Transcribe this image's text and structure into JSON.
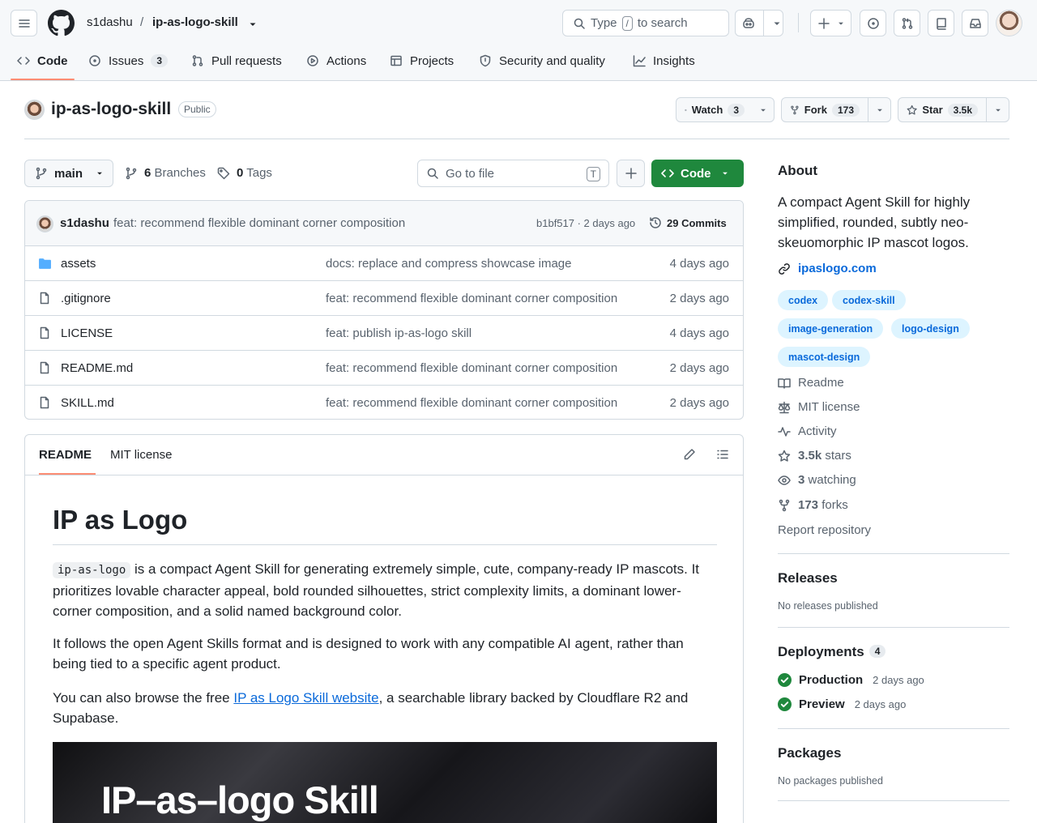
{
  "header": {
    "owner": "s1dashu",
    "separator": "/",
    "repo": "ip-as-logo-skill",
    "search_before": "Type",
    "search_key": "/",
    "search_after": "to search"
  },
  "tabs": [
    {
      "label": "Code"
    },
    {
      "label": "Issues",
      "count": "3"
    },
    {
      "label": "Pull requests"
    },
    {
      "label": "Actions"
    },
    {
      "label": "Projects"
    },
    {
      "label": "Security and quality"
    },
    {
      "label": "Insights"
    }
  ],
  "repo": {
    "title": "ip-as-logo-skill",
    "visibility": "Public",
    "watch_label": "Watch",
    "watch_count": "3",
    "fork_label": "Fork",
    "fork_count": "173",
    "star_label": "Star",
    "star_count": "3.5k"
  },
  "toolbar": {
    "branch": "main",
    "branches_count": "6",
    "branches_label": "Branches",
    "tags_count": "0",
    "tags_label": "Tags",
    "goto_placeholder": "Go to file",
    "goto_key": "T",
    "code_label": "Code"
  },
  "commit": {
    "author": "s1dashu",
    "message": "feat: recommend flexible dominant corner composition",
    "hash_time": "b1bf517 · 2 days ago",
    "commits_label": "29 Commits"
  },
  "files": [
    {
      "name": "assets",
      "type": "folder",
      "message": "docs: replace and compress showcase image",
      "date": "4 days ago"
    },
    {
      "name": ".gitignore",
      "type": "file",
      "message": "feat: recommend flexible dominant corner composition",
      "date": "2 days ago"
    },
    {
      "name": "LICENSE",
      "type": "file",
      "message": "feat: publish ip-as-logo skill",
      "date": "4 days ago"
    },
    {
      "name": "README.md",
      "type": "file",
      "message": "feat: recommend flexible dominant corner composition",
      "date": "2 days ago"
    },
    {
      "name": "SKILL.md",
      "type": "file",
      "message": "feat: recommend flexible dominant corner composition",
      "date": "2 days ago"
    }
  ],
  "readme": {
    "tab_readme": "README",
    "tab_license": "MIT license",
    "h1": "IP as Logo",
    "p1_code": "ip-as-logo",
    "p1_text": " is a compact Agent Skill for generating extremely simple, cute, company-ready IP mascots. It prioritizes lovable character appeal, bold rounded silhouettes, strict complexity limits, a dominant lower-corner composition, and a solid named background color.",
    "p2": "It follows the open Agent Skills format and is designed to work with any compatible AI agent, rather than being tied to a specific agent product.",
    "p3_before": "You can also browse the free ",
    "p3_link": "IP as Logo Skill website",
    "p3_after": ", a searchable library backed by Cloudflare R2 and Supabase.",
    "hero_text": "IP–as–logo Skill"
  },
  "about": {
    "heading": "About",
    "description": "A compact Agent Skill for highly simplified, rounded, subtly neo-skeuomorphic IP mascot logos.",
    "url": "ipaslogo.com",
    "topics": [
      "codex",
      "codex-skill",
      "image-generation",
      "logo-design",
      "mascot-design"
    ],
    "readme": "Readme",
    "license": "MIT license",
    "activity": "Activity",
    "stars_count": "3.5k",
    "stars_label": "stars",
    "watching_count": "3",
    "watching_label": "watching",
    "forks_count": "173",
    "forks_label": "forks",
    "report": "Report repository"
  },
  "releases": {
    "heading": "Releases",
    "empty": "No releases published"
  },
  "deployments": {
    "heading": "Deployments",
    "count": "4",
    "items": [
      {
        "name": "Production",
        "time": "2 days ago"
      },
      {
        "name": "Preview",
        "time": "2 days ago"
      }
    ]
  },
  "packages": {
    "heading": "Packages",
    "empty": "No packages published"
  },
  "colors": {
    "accent": "#1f883d",
    "link": "#0969da",
    "tab_underline": "#fd8c73",
    "topic_bg": "#ddf4ff"
  }
}
